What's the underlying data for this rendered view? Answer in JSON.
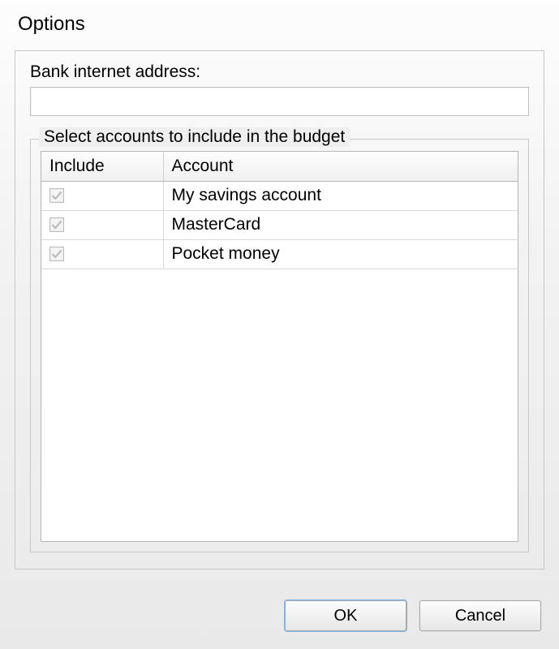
{
  "title": "Options",
  "bank_address": {
    "label": "Bank internet address:",
    "value": ""
  },
  "accounts_group": {
    "legend": "Select accounts to include in the budget",
    "columns": {
      "include": "Include",
      "account": "Account"
    },
    "rows": [
      {
        "included": true,
        "name": "My savings account"
      },
      {
        "included": true,
        "name": "MasterCard"
      },
      {
        "included": true,
        "name": "Pocket money"
      }
    ]
  },
  "buttons": {
    "ok": "OK",
    "cancel": "Cancel"
  },
  "icons": {
    "checkbox_disabled_checked": "checkbox-disabled-checked-icon"
  }
}
